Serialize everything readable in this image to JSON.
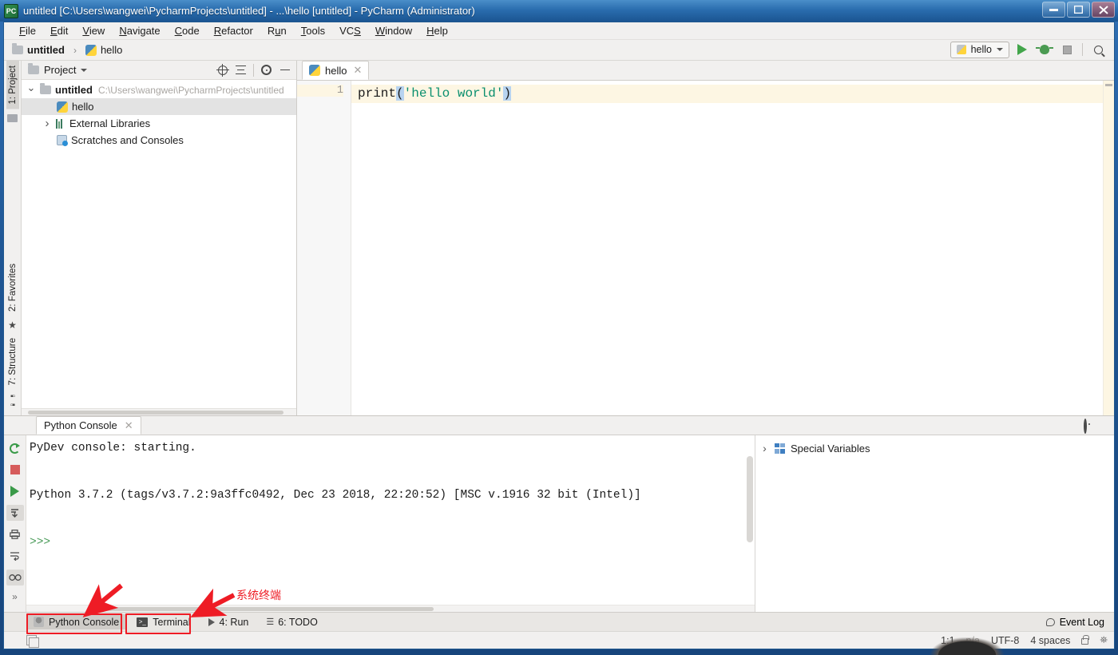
{
  "window": {
    "title": "untitled [C:\\Users\\wangwei\\PycharmProjects\\untitled] - ...\\hello [untitled] - PyCharm (Administrator)",
    "app_badge": "PC",
    "minimize_label": "—",
    "maximize_label": "❐",
    "close_label": "✕"
  },
  "menu": {
    "items": [
      {
        "label": "File",
        "mnemonic": "F"
      },
      {
        "label": "Edit",
        "mnemonic": "E"
      },
      {
        "label": "View",
        "mnemonic": "V"
      },
      {
        "label": "Navigate",
        "mnemonic": "N"
      },
      {
        "label": "Code",
        "mnemonic": "C"
      },
      {
        "label": "Refactor",
        "mnemonic": "R"
      },
      {
        "label": "Run",
        "mnemonic": "u"
      },
      {
        "label": "Tools",
        "mnemonic": "T"
      },
      {
        "label": "VCS",
        "mnemonic": "S"
      },
      {
        "label": "Window",
        "mnemonic": "W"
      },
      {
        "label": "Help",
        "mnemonic": "H"
      }
    ]
  },
  "breadcrumb": {
    "project": "untitled",
    "separator": "›",
    "file": "hello"
  },
  "run_toolbar": {
    "config_name": "hello",
    "run_tooltip": "Run",
    "debug_tooltip": "Debug",
    "stop_tooltip": "Stop",
    "search_tooltip": "Search Everywhere"
  },
  "left_strip": {
    "project_tab": "1: Project",
    "favorites_tab": "2: Favorites",
    "structure_tab": "7: Structure"
  },
  "project_panel": {
    "title": "Project",
    "dropdown_caret": "▾",
    "tree": [
      {
        "label": "untitled",
        "path": "C:\\Users\\wangwei\\PycharmProjects\\untitled",
        "icon": "folder-icon",
        "expanded": true,
        "bold": true
      },
      {
        "label": "hello",
        "icon": "python-file-icon",
        "selected": true,
        "indent": 2
      },
      {
        "label": "External Libraries",
        "icon": "library-icon",
        "expanded": false
      },
      {
        "label": "Scratches and Consoles",
        "icon": "scratch-icon"
      }
    ]
  },
  "editor": {
    "tabs": [
      {
        "label": "hello",
        "icon": "python-file-icon",
        "active": true,
        "close": "✕"
      }
    ],
    "line_number": "1",
    "code": {
      "fn": "print",
      "open_paren": "(",
      "quote_open": "'",
      "string": "hello world",
      "quote_close": "'",
      "close_paren": ")"
    }
  },
  "console": {
    "tab_label": "Python Console",
    "tab_close": "✕",
    "lines": [
      "PyDev console: starting.",
      "Python 3.7.2 (tags/v3.7.2:9a3ffc0492, Dec 23 2018, 22:20:52) [MSC v.1916 32 bit (Intel)]"
    ],
    "prompt": ">>>",
    "toolbar_icons": [
      "rerun-icon",
      "stop-icon",
      "execute-icon",
      "scroll-to-end-icon",
      "print-icon",
      "soft-wrap-icon",
      "view-as-icon",
      "more-icon"
    ],
    "more_label": "»"
  },
  "special_variables": {
    "label": "Special Variables",
    "twist": "›"
  },
  "bottom_toolbar": {
    "buttons": [
      {
        "label": "Python Console",
        "icon": "python-console-icon",
        "active": true
      },
      {
        "label": "Terminal",
        "icon": "terminal-icon",
        "active": false
      },
      {
        "label": "4: Run",
        "mnemonic": "4",
        "icon": "run-icon",
        "active": false
      },
      {
        "label": "6: TODO",
        "mnemonic": "6",
        "icon": "todo-icon",
        "active": false
      }
    ],
    "event_log": "Event Log"
  },
  "statusbar": {
    "caret_position": "1:1",
    "line_separator": "n/a",
    "encoding": "UTF-8",
    "indent": "4 spaces",
    "lock_icon": "lock-icon",
    "inspection_icon": "inspection-icon"
  },
  "annotations": {
    "terminal_label": "系统终端",
    "accent_color": "#ee1c25",
    "boxes": [
      "python-console-button",
      "terminal-button"
    ],
    "arrows": 2
  }
}
